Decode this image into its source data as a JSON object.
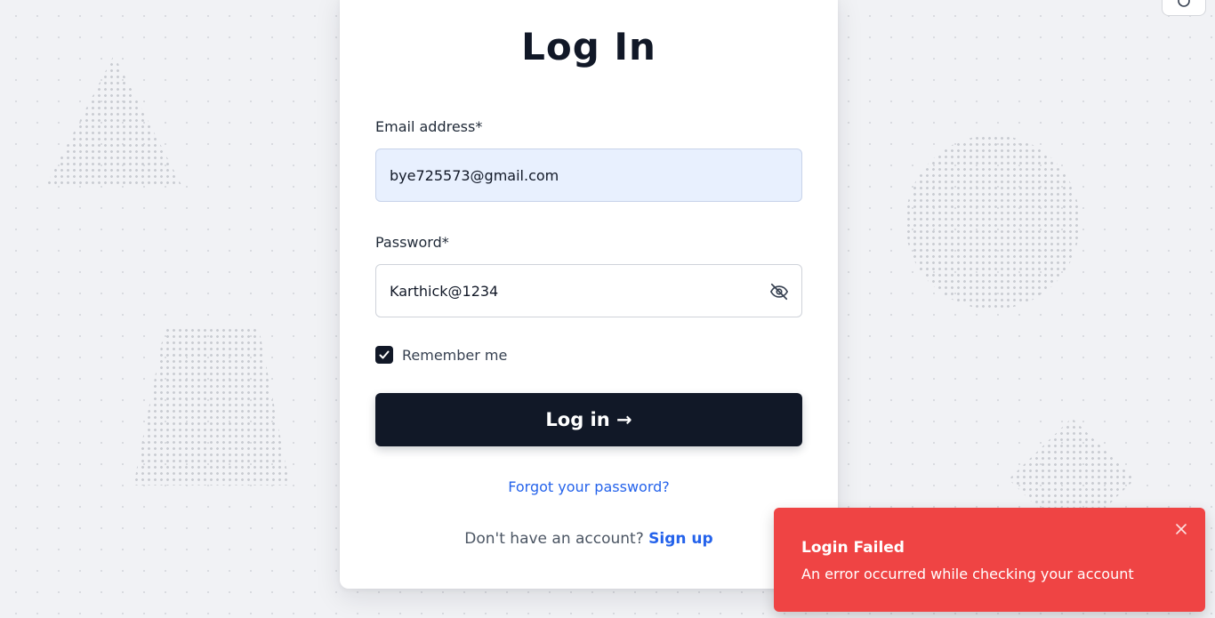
{
  "login": {
    "title": "Log In",
    "email_label": "Email address*",
    "email_value": "bye725573@gmail.com",
    "password_label": "Password*",
    "password_value": "Karthick@1234",
    "remember_label": "Remember me",
    "remember_checked": true,
    "submit_label": "Log in →",
    "forgot_label": "Forgot your password?",
    "no_account_text": "Don't have an account?",
    "signup_label": "Sign up"
  },
  "toast": {
    "title": "Login Failed",
    "message": "An error occurred while checking your account"
  },
  "icons": {
    "password_toggle": "eye-off-icon",
    "checkbox": "check-icon",
    "toast_close": "close-icon",
    "top_right": "settings-icon"
  },
  "colors": {
    "primary": "#111827",
    "link": "#2563eb",
    "toast_error": "#ef4444",
    "email_autofill_bg": "#e8f0fe"
  }
}
